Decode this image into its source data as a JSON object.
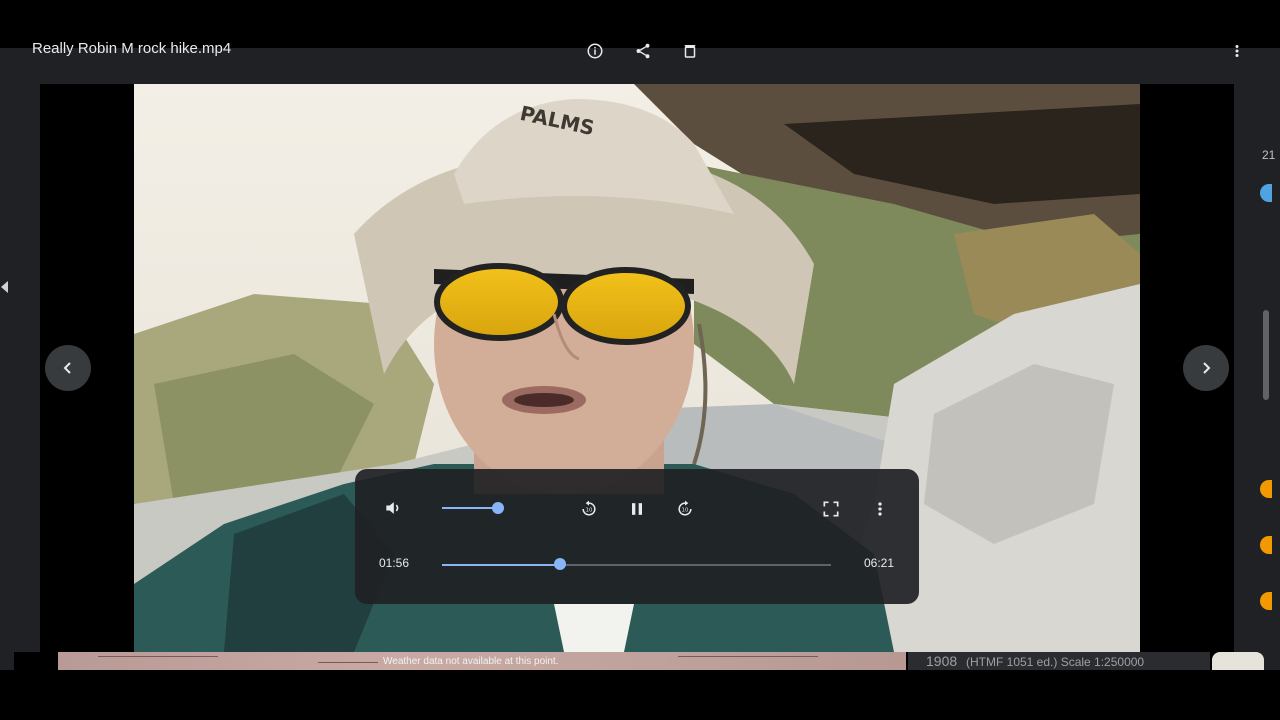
{
  "window": {
    "file_title": "Really Robin M rock hike.mp4",
    "toolbar_icons": [
      "info-icon",
      "share-icon",
      "delete-icon",
      "more-vert-icon"
    ]
  },
  "navigation": {
    "prev_icon": "chevron-left-icon",
    "next_icon": "chevron-right-icon"
  },
  "player": {
    "current_time": "01:56",
    "duration": "06:21",
    "progress": 0.3045,
    "volume": 0.85,
    "state": "playing",
    "icons": [
      "volume-icon",
      "rewind-10-icon",
      "pause-icon",
      "forward-10-icon",
      "fullscreen-icon",
      "more-vert-icon"
    ]
  },
  "video_frame": {
    "hat_text": "PALMS"
  },
  "background_app": {
    "weather_note": "Weather data not available at this point.",
    "scale_prefix": "1908",
    "scale_note": "(HTMF 1051 ed.) Scale 1:250000",
    "side_digit": "21"
  },
  "colors": {
    "accent": "#8ab4f8",
    "panel": "#202124",
    "track": "#5f6368"
  }
}
